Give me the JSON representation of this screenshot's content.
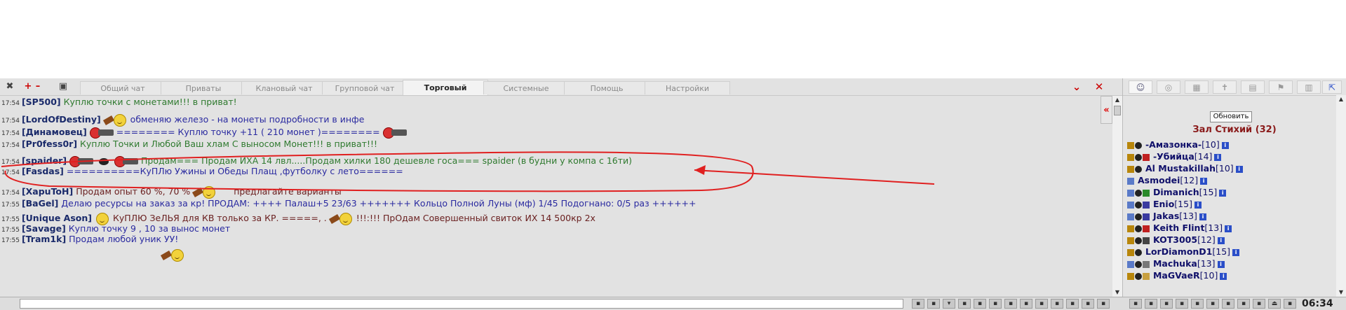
{
  "toolbar": {
    "tabs": [
      {
        "label": "Общий чат"
      },
      {
        "label": "Приваты"
      },
      {
        "label": "Клановый чат"
      },
      {
        "label": "Групповой чат"
      },
      {
        "label": "Торговый"
      },
      {
        "label": "Системные"
      },
      {
        "label": "Помощь"
      },
      {
        "label": "Настройки"
      }
    ],
    "active_tab": "Торговый",
    "collapse_symbol": "«"
  },
  "messages": [
    {
      "time": "17:54",
      "nick": "[SP500]",
      "text": "Куплю точки с монетами!!! в приват!",
      "color": "#2f7a2f"
    },
    {
      "time": "17:54",
      "nick": "[LordOfDestiny]",
      "text": "обменяю железо - на монеты подробности в инфе",
      "color": "#2a2aa0"
    },
    {
      "time": "17:54",
      "nick": "[Динамовец]",
      "text": "======== Куплю точку +11 ( 210 монет )========",
      "color": "#2a2aa0"
    },
    {
      "time": "17:54",
      "nick": "[Pr0fess0r]",
      "text": "Куплю Точки и Любой Ваш хлам С выносом Монет!!! в приват!!!",
      "color": "#2f7a2f"
    },
    {
      "time": "17:54",
      "nick": "[spaider]",
      "text": "Продам=== Продам ИХА 14 лвл.....Продам хилки 180 дешевле госа=== spaider (в будни у компа с 16ти)",
      "color": "#2f7a2f"
    },
    {
      "time": "17:54",
      "nick": "[Fasdas]",
      "text": "==========КуПЛю Ужины и Обеды Плащ ,футболку с лето======",
      "color": "#2a2aa0"
    },
    {
      "time": "17:54",
      "nick": "[XapuToH]",
      "text": "Продам опыт 60 %, 70 %",
      "text2": "предлагайте варианты",
      "color": "#6a2020"
    },
    {
      "time": "17:55",
      "nick": "[BaGel]",
      "text": "Делаю ресурсы на заказ за кр! ПРОДАМ: ++++ Палаш+5 23/63 +++++++ Кольцо Полной Луны (мф) 1/45 Подогнано: 0/5 раз ++++++",
      "color": "#2a2aa0"
    },
    {
      "time": "17:55",
      "nick": "[Unique Ason]",
      "text": "КуПЛЮ ЗеЛЬЯ для КВ только за КР. =====, .",
      "text2": "!!!:!!! ПрОдам Совершенный свиток ИХ 14 500кр 2х",
      "color": "#6a2020"
    },
    {
      "time": "17:55",
      "nick": "[Savage]",
      "text": "Куплю точку 9 , 10 за вынос монет",
      "color": "#2a2aa0"
    },
    {
      "time": "17:55",
      "nick": "[Tram1k]",
      "text": "Продам любой уник УУ!",
      "color": "#2a2aa0"
    }
  ],
  "panel": {
    "refresh_label": "Обновить",
    "room_title": "Зал Стихий (32)",
    "users": [
      {
        "name": "-Амазонка-",
        "level": "[10]"
      },
      {
        "name": "-Убийца",
        "level": "[14]"
      },
      {
        "name": "Al Mustakillah",
        "level": "[10]"
      },
      {
        "name": "Asmodei",
        "level": "[12]"
      },
      {
        "name": "Dimanich",
        "level": "[15]"
      },
      {
        "name": "Enio",
        "level": "[15]"
      },
      {
        "name": "Jakas",
        "level": "[13]"
      },
      {
        "name": "Keith Flint",
        "level": "[13]"
      },
      {
        "name": "KOT3005",
        "level": "[12]"
      },
      {
        "name": "LorDiamonD1",
        "level": "[15]"
      },
      {
        "name": "Machuka",
        "level": "[13]"
      },
      {
        "name": "MaGVaeR",
        "level": "[10]"
      }
    ],
    "info_symbol": "i"
  },
  "bottom": {
    "clock": "06:34"
  },
  "colors": {
    "annotation": "#e02020",
    "nick": "#1a2a6a",
    "room_title": "#8a1a1a"
  }
}
